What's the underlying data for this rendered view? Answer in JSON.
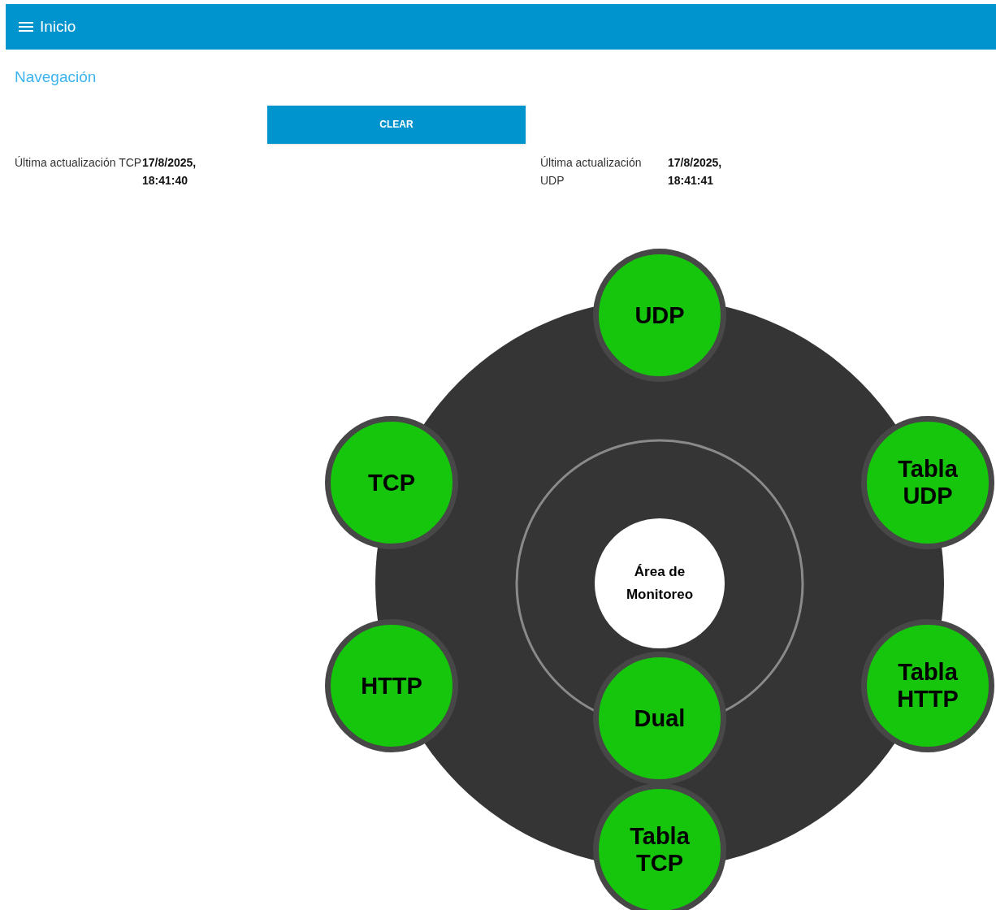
{
  "header": {
    "title": "Inicio"
  },
  "navigation": {
    "heading": "Navegación"
  },
  "clear_button": {
    "label": "CLEAR"
  },
  "updates": [
    {
      "label": "Última actualización TCP",
      "value": "17/8/2025, 18:41:40"
    },
    {
      "label": "Última actualización UDP",
      "value": "17/8/2025, 18:41:41"
    }
  ],
  "dial": {
    "center": "Área de Monitoreo",
    "nodes": [
      {
        "label": "UDP"
      },
      {
        "label": "TCP"
      },
      {
        "label": "Tabla UDP"
      },
      {
        "label": "HTTP"
      },
      {
        "label": "Tabla HTTP"
      },
      {
        "label": "Dual"
      },
      {
        "label": "Tabla TCP"
      }
    ]
  }
}
